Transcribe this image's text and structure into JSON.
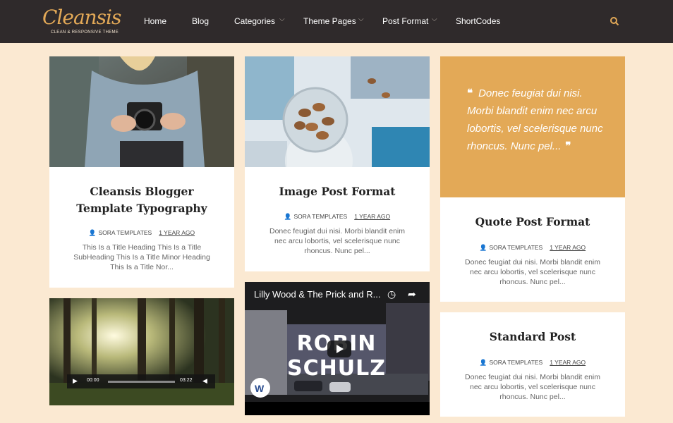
{
  "brand": {
    "logo_text": "Cleansis",
    "tagline": "CLEAN & RESPONSIVE THEME",
    "accent_color": "#e3a957",
    "header_bg": "#2f2a2b",
    "page_bg": "#fbe9d2"
  },
  "nav": {
    "items": [
      {
        "label": "Home",
        "has_dropdown": false
      },
      {
        "label": "Blog",
        "has_dropdown": false
      },
      {
        "label": "Categories",
        "has_dropdown": true
      },
      {
        "label": "Theme Pages",
        "has_dropdown": true
      },
      {
        "label": "Post Format",
        "has_dropdown": true
      },
      {
        "label": "ShortCodes",
        "has_dropdown": false
      }
    ],
    "search_icon": "search-icon"
  },
  "posts": [
    {
      "title": "Cleansis Blogger Template Typography",
      "author": "SORA TEMPLATES",
      "date": "1 YEAR AGO",
      "excerpt": "This Is a Title Heading This Is a Title SubHeading This Is a Title Minor Heading This Is a Title Nor..."
    },
    {
      "title": "Image Post Format",
      "author": "SORA TEMPLATES",
      "date": "1 YEAR AGO",
      "excerpt": "Donec feugiat dui nisi. Morbi blandit enim nec arcu lobortis, vel scelerisque nunc rhoncus. Nunc pel..."
    },
    {
      "title": "Quote Post Format",
      "author": "SORA TEMPLATES",
      "date": "1 YEAR AGO",
      "excerpt": "Donec feugiat dui nisi. Morbi blandit enim nec arcu lobortis, vel scelerisque nunc rhoncus. Nunc pel...",
      "quote": "Donec feugiat dui nisi. Morbi blandit enim nec arcu lobortis, vel scelerisque nunc rhoncus. Nunc pel..."
    },
    {
      "title": "Standard Post",
      "author": "SORA TEMPLATES",
      "date": "1 YEAR AGO",
      "excerpt": "Donec feugiat dui nisi. Morbi blandit enim nec arcu lobortis, vel scelerisque nunc rhoncus. Nunc pel..."
    }
  ],
  "audio_player": {
    "current_time": "00:00",
    "duration": "03:22"
  },
  "video": {
    "title": "Lilly Wood & The Prick and R...",
    "overlay_text": "ROBIN SCHULZ"
  }
}
